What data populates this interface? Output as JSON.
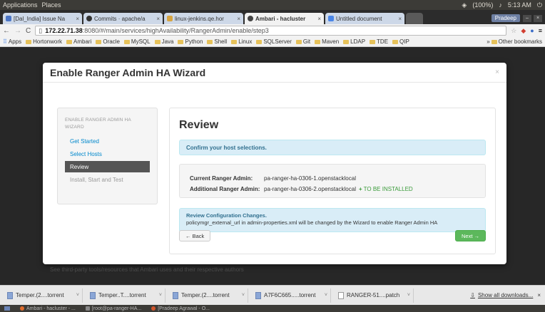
{
  "os_panel": {
    "applications": "Applications",
    "places": "Places",
    "battery": "(100%)",
    "time": "5:13 AM"
  },
  "browser": {
    "tabs": [
      {
        "label": "[Dal_India] Issue Na",
        "color": "#4b75c6"
      },
      {
        "label": "Commits · apache/a",
        "color": "#333333"
      },
      {
        "label": "linux-jenkins.qe.hor",
        "color": "#d7a542"
      },
      {
        "label": "Ambari - hacluster",
        "color": "#444444"
      },
      {
        "label": "Untitled document",
        "color": "#4a86e8"
      }
    ],
    "user": "Pradeep",
    "url_host": "172.22.71.38",
    "url_rest": ":8080/#/main/services/highAvailability/RangerAdmin/enable/step3",
    "bookmarks": [
      "Apps",
      "Hortonwork",
      "Ambari",
      "Oracle",
      "MySQL",
      "Java",
      "Python",
      "Shell",
      "Linux",
      "SQLServer",
      "Git",
      "Maven",
      "LDAP",
      "TDE",
      "QIP"
    ],
    "other_bookmarks": "Other bookmarks"
  },
  "modal": {
    "title": "Enable Ranger Admin HA Wizard",
    "close": "×",
    "sidebar": {
      "heading": "ENABLE RANGER ADMIN HA WIZARD",
      "steps": [
        "Get Started",
        "Select Hosts",
        "Review",
        "Install, Start and Test"
      ]
    },
    "review": {
      "title": "Review",
      "confirm": "Confirm your host selections.",
      "current_label": "Current Ranger Admin:",
      "current_value": "pa-ranger-ha-0306-1.openstacklocal",
      "additional_label": "Additional Ranger Admin:",
      "additional_value": "pa-ranger-ha-0306-2.openstacklocal",
      "installed": "TO BE INSTALLED",
      "config_title": "Review Configuration Changes.",
      "config_text": "policymgr_external_url in admin-properties.xml will be changed by the Wizard to enable Ranger Admin HA",
      "back": "← Back",
      "next": "Next →"
    }
  },
  "page_footer": "See third-party tools/resources that Ambari uses and their respective authors",
  "downloads": {
    "items": [
      "Temper.(2....torrent",
      "Temper..T....torrent",
      "Temper.(2....torrent",
      "A7F6C665.....torrent",
      "RANGER-51....patch"
    ],
    "show_all": "Show all downloads..."
  },
  "taskbar": {
    "tasks": [
      "Ambari - hacluster - ...",
      "[root@pa-ranger-HA...",
      "[Pradeep Agrawal - O..."
    ]
  }
}
